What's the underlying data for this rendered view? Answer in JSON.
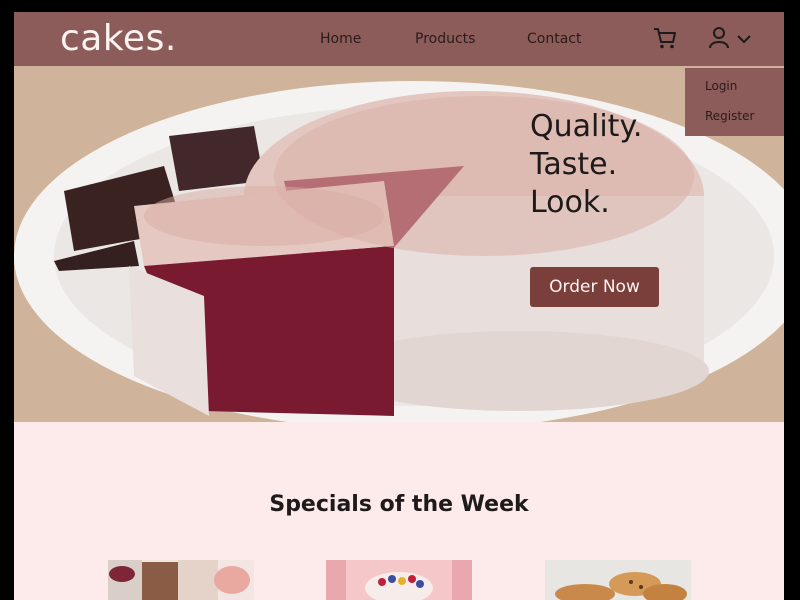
{
  "header": {
    "logo": "cakes.",
    "nav": [
      {
        "label": "Home"
      },
      {
        "label": "Products"
      },
      {
        "label": "Contact"
      }
    ],
    "cart_icon": "cart-icon",
    "user_icon": "user-icon",
    "chevron_icon": "chevron-down-icon"
  },
  "account_menu": {
    "items": [
      {
        "label": "Login"
      },
      {
        "label": "Register"
      }
    ]
  },
  "hero": {
    "tagline": [
      "Quality.",
      "Taste.",
      "Look."
    ],
    "cta_label": "Order Now"
  },
  "specials": {
    "title": "Specials of the Week",
    "cards": [
      {
        "image": "assorted-desserts-photo"
      },
      {
        "image": "fruit-cake-photo"
      },
      {
        "image": "cookies-photo"
      }
    ]
  },
  "colors": {
    "header": "#8b5c5a",
    "page_background": "#fcebea",
    "button": "#7a3f3a",
    "button_text": "#fff3f1"
  }
}
